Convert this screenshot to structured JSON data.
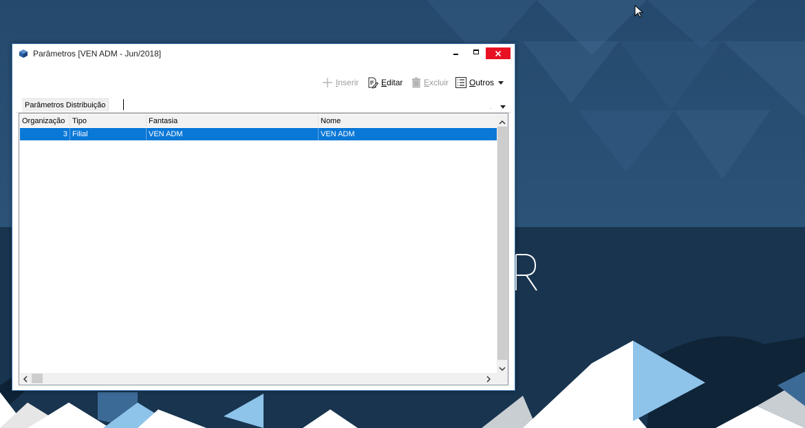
{
  "window": {
    "title": "Parâmetros [VEN ADM - Jun/2018]"
  },
  "toolbar": {
    "inserir": {
      "label": "Inserir",
      "icon": "plus-icon",
      "enabled": false
    },
    "editar": {
      "label": "Editar",
      "icon": "edit-document-icon",
      "enabled": true
    },
    "excluir": {
      "label": "Excluir",
      "icon": "trash-icon",
      "enabled": false
    },
    "outros": {
      "label": "Outros",
      "icon": "list-icon",
      "enabled": true
    }
  },
  "tabs": [
    {
      "label": "Parâmetros Distribuição",
      "active": true
    }
  ],
  "grid": {
    "columns": [
      "Organização",
      "Tipo",
      "Fantasia",
      "Nome"
    ],
    "rows": [
      {
        "organizacao": "3",
        "tipo": "Filial",
        "fantasia": "VEN ADM",
        "nome": "VEN ADM",
        "selected": true
      }
    ]
  },
  "desktop": {
    "wallpaper_letter": "R",
    "colors": {
      "sky": "#2a4f74",
      "sea": "#17334f",
      "accent": "#8ec3ea",
      "selection": "#0a78d7",
      "close": "#e81123"
    }
  }
}
